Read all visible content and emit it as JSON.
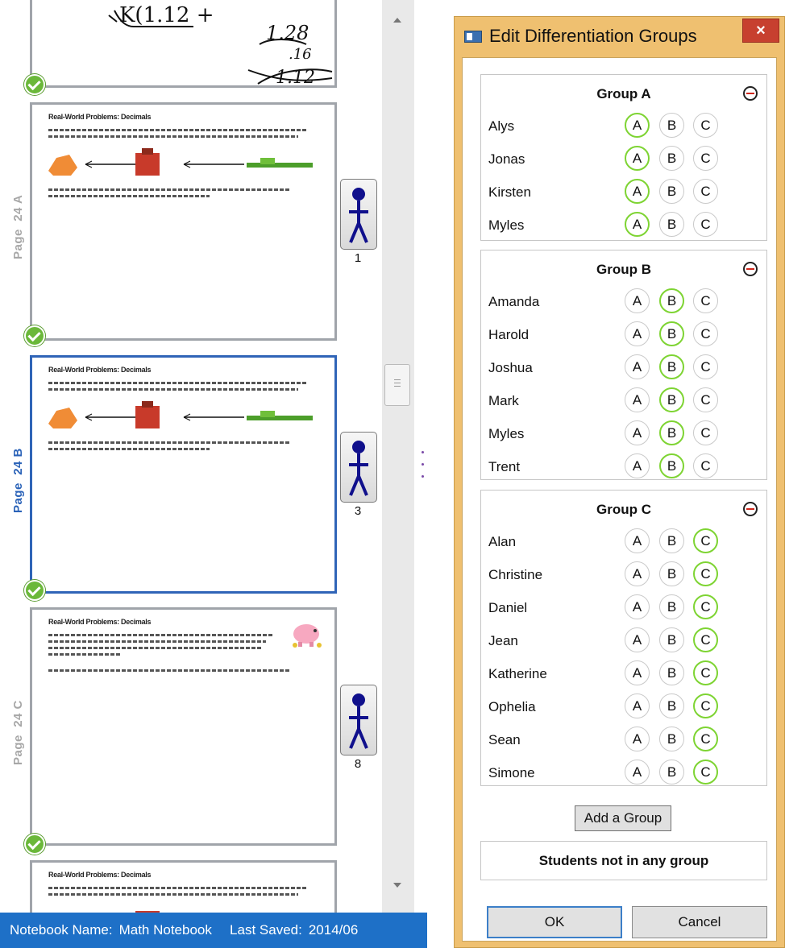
{
  "thumbnails": [
    {
      "label_page": "Page",
      "label_id": "24 A",
      "title": "Real-World Problems: Decimals",
      "student_count": "1"
    },
    {
      "label_page": "Page",
      "label_id": "24 B",
      "title": "Real-World Problems: Decimals",
      "student_count": "3"
    },
    {
      "label_page": "Page",
      "label_id": "24 C",
      "title": "Real-World Problems: Decimals",
      "student_count": "8"
    },
    {
      "title": "Real-World Problems: Decimals"
    }
  ],
  "handwriting": {
    "line1": "K(1.12 +",
    "line2": "1.28",
    "line3": ".16",
    "line4": "1.12"
  },
  "status_bar": {
    "notebook_label": "Notebook Name:",
    "notebook_name": "Math Notebook",
    "saved_label": "Last Saved:",
    "saved_value": "2014/06"
  },
  "dialog": {
    "title": "Edit Differentiation Groups",
    "close_glyph": "×",
    "option_labels": {
      "a": "A",
      "b": "B",
      "c": "C"
    },
    "groups": [
      {
        "title": "Group A",
        "selected": "A",
        "students": [
          "Alys",
          "Jonas",
          "Kirsten",
          "Myles"
        ]
      },
      {
        "title": "Group B",
        "selected": "B",
        "students": [
          "Amanda",
          "Harold",
          "Joshua",
          "Mark",
          "Myles",
          "Trent"
        ]
      },
      {
        "title": "Group C",
        "selected": "C",
        "students": [
          "Alan",
          "Christine",
          "Daniel",
          "Jean",
          "Katherine",
          "Ophelia",
          "Sean",
          "Simone"
        ]
      }
    ],
    "add_group_label": "Add a Group",
    "ungrouped_label": "Students not in any group",
    "ok_label": "OK",
    "cancel_label": "Cancel"
  },
  "colors": {
    "accent": "#2f64b7",
    "selected_ring": "#7ed433",
    "remove_icon": "#d0261c",
    "dialog_frame": "#efc070",
    "status_bar": "#1e70c7"
  }
}
